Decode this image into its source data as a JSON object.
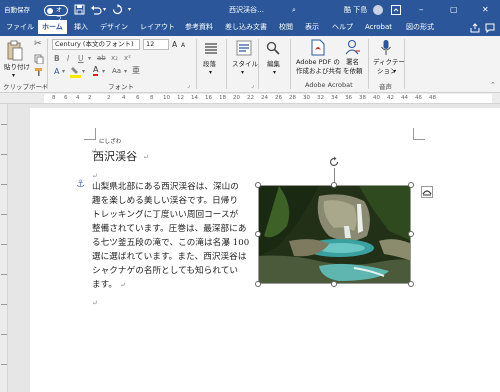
{
  "titlebar": {
    "autosave_label": "自動保存",
    "autosave_state": "オフ",
    "doc_title": "西沢渓谷…",
    "user_name": "酷 下島"
  },
  "tabs": [
    "ファイル",
    "ホーム",
    "挿入",
    "デザイン",
    "レイアウト",
    "参考資料",
    "差し込み文書",
    "校閲",
    "表示",
    "ヘルプ",
    "Acrobat",
    "図の形式"
  ],
  "active_tab": "ホーム",
  "ribbon": {
    "paste_label": "貼り付け",
    "clipboard_group": "クリップボード",
    "font_name": "Century (本文のフォント)",
    "font_size": "12",
    "font_group": "フォント",
    "bold": "B",
    "italic": "I",
    "underline": "U",
    "strike": "ab",
    "subscript": "x₂",
    "superscript": "x²",
    "font_color_glyph": "A",
    "grow_font": "A",
    "shrink_font": "A",
    "aa_label": "Aa",
    "ruby_glyph": "亜",
    "paragraph_label": "段落",
    "style_label": "スタイル",
    "edit_label": "編集",
    "pdf_label1": "Adobe PDF の",
    "pdf_label2": "作成および共有",
    "sign_label1": "署名",
    "sign_label2": "を依頼",
    "acrobat_group": "Adobe Acrobat",
    "dictation_label": "ディクテー",
    "dictation_label2": "ション",
    "voice_group": "音声"
  },
  "ruler": {
    "left_labels": [
      "8",
      "6",
      "4",
      "2"
    ],
    "labels": [
      "2",
      "4",
      "6",
      "8",
      "10",
      "12",
      "14",
      "16",
      "18",
      "20",
      "22",
      "24",
      "26",
      "28",
      "30",
      "32",
      "34",
      "36",
      "38",
      "40",
      "42",
      "44",
      "46",
      "48"
    ]
  },
  "document": {
    "ruby": "にしざわ",
    "title": "西沢渓谷",
    "pilcrow": "↵",
    "paragraph_lines": [
      "山梨県北部にある西沢渓谷は、深山の",
      "趣を楽しめる美しい渓谷です。日帰り",
      "トレッキングに丁度いい周回コースが",
      "整備されています。圧巻は、最深部にあ",
      "る七ツ釜五段の滝で、この滝は名瀑 100",
      "選に選ばれています。また、西沢渓谷は",
      "シャクナゲの名所としても知られてい",
      "ます。"
    ]
  },
  "colors": {
    "brand": "#2b579a",
    "font_color_red": "#e02020",
    "highlight_yellow": "#ffe800",
    "pdf_red": "#c0392b"
  }
}
